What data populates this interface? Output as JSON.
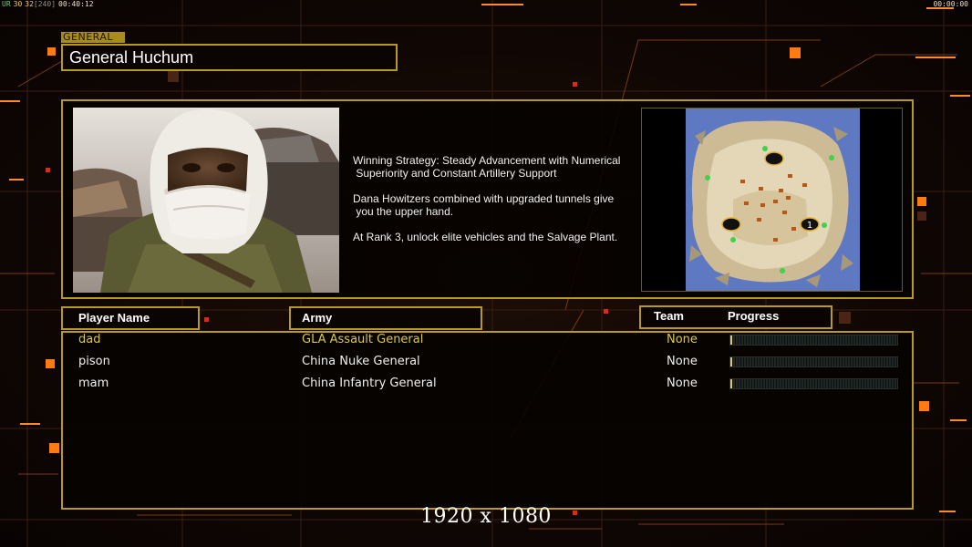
{
  "hud": {
    "left": [
      {
        "text": "UR",
        "color": "#5fd35f"
      },
      {
        "text": "30",
        "color": "#e8d26a"
      },
      {
        "text": "32",
        "color": "#e8d26a"
      },
      {
        "text": "[240]",
        "color": "#8f8f8f"
      },
      {
        "text": "00:40:12",
        "color": "#e8e0c8"
      }
    ],
    "right": "00:00:00"
  },
  "general": {
    "tag": "GENERAL",
    "name": "General Huchum"
  },
  "briefing": {
    "paragraphs": [
      "Winning Strategy: Steady Advancement with Numerical\n Superiority and Constant Artillery Support",
      "Dana Howitzers combined with upgraded tunnels give\n you the upper hand.",
      "At Rank 3, unlock elite vehicles and the Salvage Plant."
    ],
    "portrait_icon": "general-portrait",
    "map_icon": "minimap"
  },
  "minimap": {
    "start_marker_label": "1"
  },
  "table": {
    "headers": {
      "player": "Player Name",
      "army": "Army",
      "team": "Team",
      "progress": "Progress"
    },
    "rows": [
      {
        "player": "dad",
        "army": "GLA Assault General",
        "team": "None",
        "progress": 0.012,
        "highlight": true
      },
      {
        "player": "pison",
        "army": "China Nuke General",
        "team": "None",
        "progress": 0.012,
        "highlight": false
      },
      {
        "player": "mam",
        "army": "China Infantry General",
        "team": "None",
        "progress": 0.012,
        "highlight": false
      }
    ]
  },
  "resolution": "1920 x 1080",
  "colors": {
    "accent_gold": "#b89a1e",
    "highlight_text": "#d8c84a",
    "normal_text": "#f0f0f0",
    "background": "#0d0604",
    "orange": "#ff7a10"
  }
}
